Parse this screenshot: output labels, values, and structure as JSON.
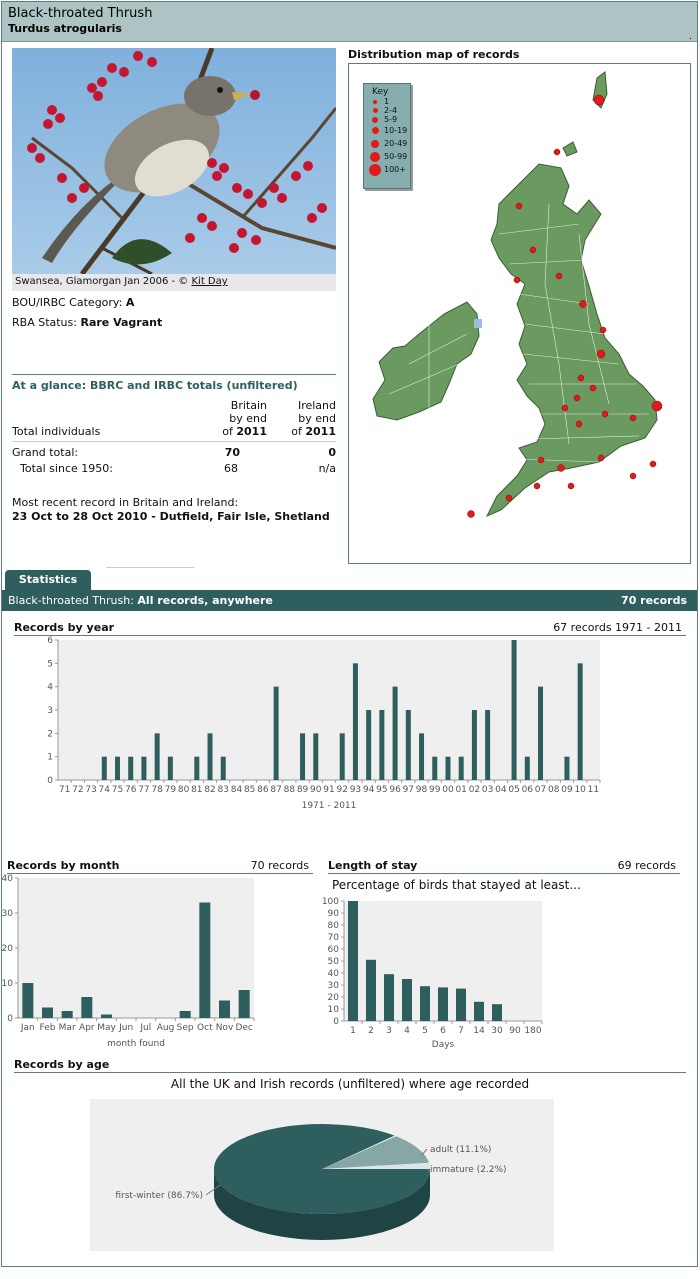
{
  "header": {
    "common_name": "Black-throated Thrush",
    "latin_name": "Turdus atrogularis",
    "corner_mark": "."
  },
  "photo": {
    "caption_prefix": "Swansea, Glamorgan Jan 2006 - ©",
    "caption_credit": "Kit Day"
  },
  "category": {
    "label": "BOU/IRBC Category:",
    "value": "A"
  },
  "rba": {
    "label": "RBA Status:",
    "value": "Rare Vagrant"
  },
  "glance": {
    "title": "At a glance: BBRC and IRBC totals (unfiltered)",
    "col_britain": [
      "Britain",
      "by end",
      "of"
    ],
    "col_ireland": [
      "Ireland",
      "by end",
      "of"
    ],
    "year": "2011",
    "total_individuals_label": "Total individuals",
    "grand_total_label": "Grand total:",
    "grand_total_britain": "70",
    "grand_total_ireland": "0",
    "since1950_label": "Total since 1950:",
    "since1950_britain": "68",
    "since1950_ireland": "n/a",
    "recent_label": "Most recent record in Britain and Ireland:",
    "recent_value": "23 Oct to 28 Oct 2010 - Dutfield, Fair Isle, Shetland"
  },
  "map": {
    "title": "Distribution map of records",
    "key_title": "Key",
    "key_items": [
      "1",
      "2-4",
      "5-9",
      "10-19",
      "20-49",
      "50-99",
      "100+"
    ],
    "land_color": "#6a9a5f",
    "dot_color": "#e01b1b"
  },
  "tabs": {
    "statistics": "Statistics"
  },
  "stat_bar": {
    "species": "Black-throated Thrush:",
    "scope": "All records, anywhere",
    "total": "70 records"
  },
  "colors": {
    "bar": "#2f5e5e",
    "plot_bg": "#efefef"
  },
  "chart_data": [
    {
      "type": "bar",
      "title": "Records by year",
      "summary": "67 records 1971 - 2011",
      "xlabel": "1971 - 2011",
      "ylim": [
        0,
        6
      ],
      "yticks": [
        0,
        1,
        2,
        3,
        4,
        5,
        6
      ],
      "categories": [
        "71",
        "72",
        "73",
        "74",
        "75",
        "76",
        "77",
        "78",
        "79",
        "80",
        "81",
        "82",
        "83",
        "84",
        "85",
        "86",
        "87",
        "88",
        "89",
        "90",
        "91",
        "92",
        "93",
        "94",
        "95",
        "96",
        "97",
        "98",
        "99",
        "00",
        "01",
        "02",
        "03",
        "04",
        "05",
        "06",
        "07",
        "08",
        "09",
        "10",
        "11"
      ],
      "values": [
        0,
        0,
        0,
        1,
        1,
        1,
        1,
        2,
        1,
        0,
        1,
        2,
        1,
        0,
        0,
        0,
        4,
        0,
        2,
        2,
        0,
        2,
        5,
        3,
        3,
        4,
        3,
        2,
        1,
        1,
        1,
        3,
        3,
        0,
        6,
        1,
        4,
        0,
        1,
        5,
        0
      ]
    },
    {
      "type": "bar",
      "title": "Records by month",
      "summary": "70 records",
      "xlabel": "month found",
      "ylim": [
        0,
        40
      ],
      "yticks": [
        0,
        10,
        20,
        30,
        40
      ],
      "categories": [
        "Jan",
        "Feb",
        "Mar",
        "Apr",
        "May",
        "Jun",
        "Jul",
        "Aug",
        "Sep",
        "Oct",
        "Nov",
        "Dec"
      ],
      "values": [
        10,
        3,
        2,
        6,
        1,
        0,
        0,
        0,
        2,
        33,
        5,
        8
      ]
    },
    {
      "type": "bar",
      "title": "Length of stay",
      "summary": "69 records",
      "subtitle": "Percentage of birds that stayed at least...",
      "xlabel": "Days",
      "ylim": [
        0,
        100
      ],
      "yticks": [
        0,
        10,
        20,
        30,
        40,
        50,
        60,
        70,
        80,
        90,
        100
      ],
      "categories": [
        "1",
        "2",
        "3",
        "4",
        "5",
        "6",
        "7",
        "14",
        "30",
        "90",
        "180"
      ],
      "values": [
        100,
        51,
        39,
        35,
        29,
        28,
        27,
        16,
        14,
        0,
        0
      ]
    },
    {
      "type": "pie",
      "title": "Records by age",
      "subtitle": "All the UK and Irish records (unfiltered) where age recorded",
      "slices": [
        {
          "label": "first-winter (86.7%)",
          "value": 86.7,
          "color": "#2f5e5e"
        },
        {
          "label": "adult (11.1%)",
          "value": 11.1,
          "color": "#86a7a5"
        },
        {
          "label": "immature (2.2%)",
          "value": 2.2,
          "color": "#d8e6e6"
        }
      ]
    }
  ]
}
